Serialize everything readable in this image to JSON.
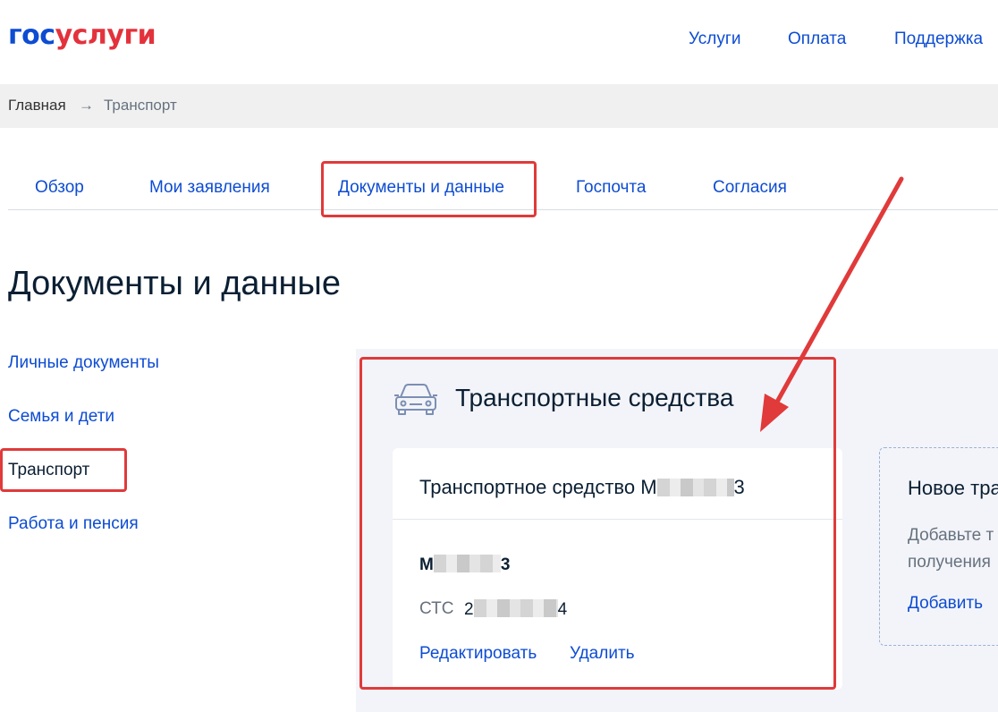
{
  "header": {
    "logo_part1": "гос",
    "logo_part2": "услуги",
    "nav": [
      "Услуги",
      "Оплата",
      "Поддержка"
    ]
  },
  "breadcrumb": {
    "home": "Главная",
    "separator": "→",
    "current": "Транспорт"
  },
  "tabs": [
    "Обзор",
    "Мои заявления",
    "Документы и данные",
    "Госпочта",
    "Согласия"
  ],
  "page_title": "Документы и данные",
  "side_menu": [
    "Личные документы",
    "Семья и дети",
    "Транспорт",
    "Работа и пенсия"
  ],
  "section": {
    "title": "Транспортные средства",
    "icon": "car-icon"
  },
  "vehicle_card": {
    "title_prefix": "Транспортное средство М",
    "title_suffix": "3",
    "plate_prefix": "М",
    "plate_suffix": "3",
    "sts_label": "СТС",
    "sts_prefix": "2",
    "sts_suffix": "4",
    "edit_label": "Редактировать",
    "delete_label": "Удалить"
  },
  "new_card": {
    "title": "Новое тра",
    "desc_line1": "Добавьте т",
    "desc_line2": "получения",
    "add_label": "Добавить"
  },
  "colors": {
    "link": "#0d4cd3",
    "logo_red": "#e3323c",
    "annotation_red": "#e03a3a"
  }
}
